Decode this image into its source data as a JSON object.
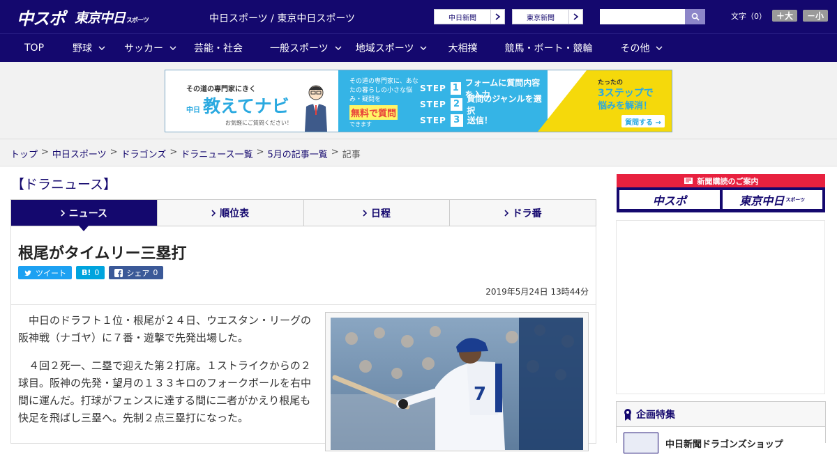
{
  "header": {
    "logo_main": "中スポ",
    "logo_sub": "東京中日",
    "logo_sub_small": "スポーツ",
    "site_names": "中日スポーツ / 東京中日スポーツ",
    "paper_links": [
      "中日新聞",
      "東京新聞"
    ],
    "search": {
      "placeholder": ""
    },
    "fontsize": {
      "label": "文字（0）",
      "larger": "＋大",
      "smaller": "－小"
    }
  },
  "nav": [
    {
      "label": "TOP",
      "dropdown": false
    },
    {
      "label": "野球",
      "dropdown": true
    },
    {
      "label": "サッカー",
      "dropdown": true
    },
    {
      "label": "芸能・社会",
      "dropdown": false
    },
    {
      "label": "一般スポーツ",
      "dropdown": true
    },
    {
      "label": "地域スポーツ",
      "dropdown": true
    },
    {
      "label": "大相撲",
      "dropdown": false
    },
    {
      "label": "競馬・ボート・競輪",
      "dropdown": false
    },
    {
      "label": "その他",
      "dropdown": true
    }
  ],
  "banner": {
    "kicker": "その道の専門家にきく",
    "brand_small": "中日",
    "brand": "教えてナビ",
    "footnote": "お気軽にご質問ください！",
    "intro": "その道の専門家に、あなたの暮らしの小さな悩み・疑問を",
    "free": "無料で質問",
    "dekimasu": "できます",
    "steps": [
      {
        "label": "STEP",
        "num": "1",
        "text": "フォームに質問内容を入力"
      },
      {
        "label": "STEP",
        "num": "2",
        "text": "質問のジャンルを選択"
      },
      {
        "label": "STEP",
        "num": "3",
        "text": "送信！"
      }
    ],
    "right_t1": "たったの",
    "right_t2": "3ステップで",
    "right_t3": "悩みを解消！",
    "cta": "質問する →"
  },
  "breadcrumb": {
    "links": [
      "トップ",
      "中日スポーツ",
      "ドラゴンズ",
      "ドラニュース一覧",
      "5月の記事一覧"
    ],
    "current": "記事",
    "sep": ">"
  },
  "section_title": "【ドラニュース】",
  "tabs": [
    "ニュース",
    "順位表",
    "日程",
    "ドラ番"
  ],
  "article": {
    "headline": "根尾がタイムリー三塁打",
    "shares": {
      "tweet": "ツイート",
      "hatena_icon": "B!",
      "hatena_count": "0",
      "fb_label": "シェア",
      "fb_count": "0"
    },
    "date": "2019年5月24日 13時44分",
    "paragraphs": [
      "中日のドラフト１位・根尾が２４日、ウエスタン・リーグの阪神戦（ナゴヤ）に７番・遊撃で先発出場した。",
      "４回２死一、二塁で迎えた第２打席。１ストライクからの２球目。阪神の先発・望月の１３３キロのフォークボールを右中間に運んだ。打球がフェンスに達する間に二者がかえり根尾も快足を飛ばし三塁へ。先制２点三塁打になった。"
    ]
  },
  "sidebar": {
    "subscribe_header": "新聞購読のご案内",
    "paper_buttons": [
      {
        "label": "中スポ",
        "small": ""
      },
      {
        "label": "東京中日",
        "small": "スポーツ"
      }
    ],
    "feature_title": "企画特集",
    "feature_item": "中日新聞ドラゴンズショップ"
  },
  "colors": {
    "brand": "#14086e",
    "accent_red": "#e8213f",
    "twitter": "#1da1f2",
    "hatena": "#00a4de",
    "facebook": "#3b5998"
  }
}
